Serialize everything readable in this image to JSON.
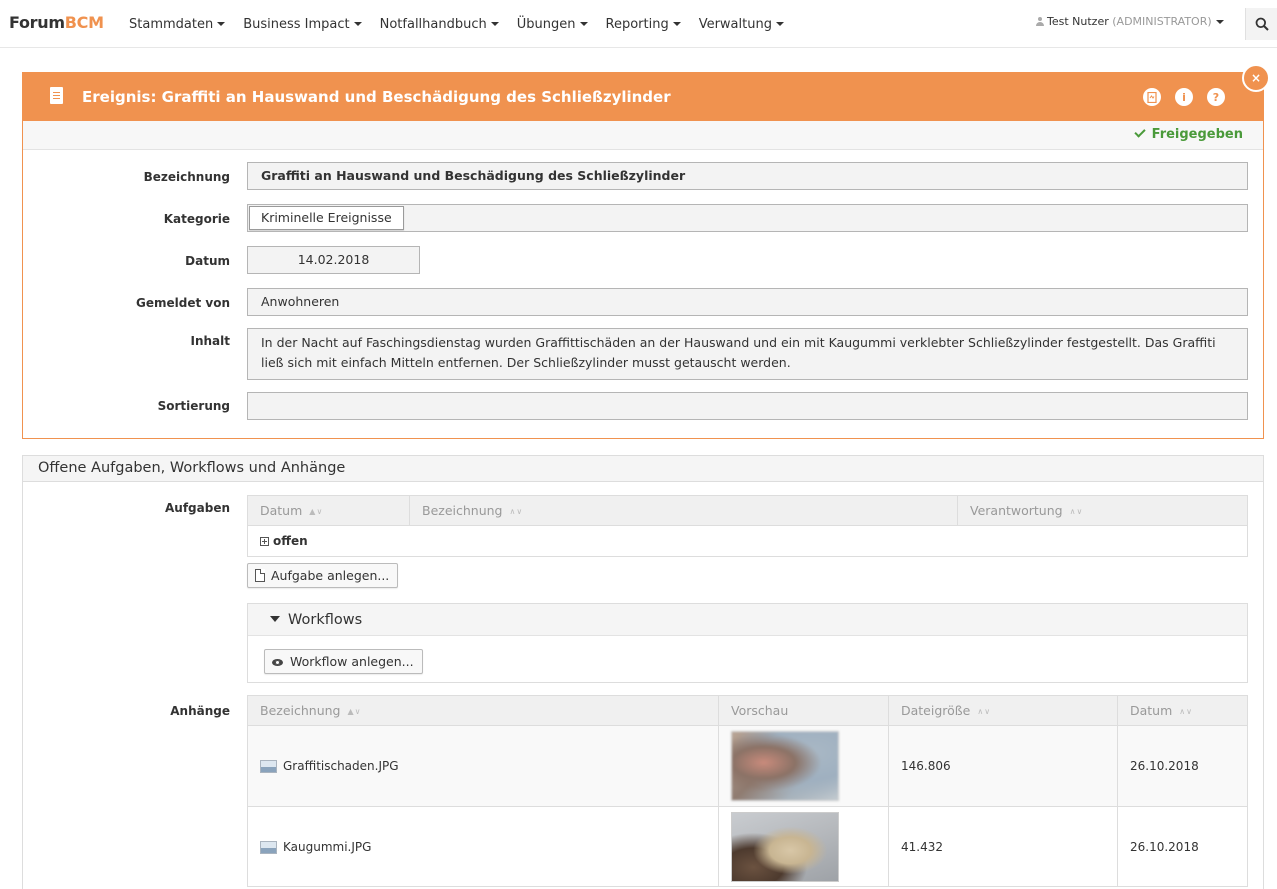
{
  "navbar": {
    "brand_prefix": "Forum",
    "brand_accent": "BCM",
    "menu": [
      {
        "label": "Stammdaten"
      },
      {
        "label": "Business Impact"
      },
      {
        "label": "Notfallhandbuch"
      },
      {
        "label": "Übungen"
      },
      {
        "label": "Reporting"
      },
      {
        "label": "Verwaltung"
      }
    ],
    "user_name": "Test Nutzer",
    "user_role": "(ADMINISTRATOR)",
    "search_icon": "search-icon"
  },
  "event": {
    "title": "Ereignis: Graffiti an Hauswand und Beschädigung des Schließzylinder",
    "header_icons": [
      "pdf-icon",
      "info-icon",
      "help-icon"
    ],
    "close_icon": "close-icon",
    "status": "Freigegeben",
    "fields": {
      "bezeichnung_label": "Bezeichnung",
      "bezeichnung_value": "Graffiti an Hauswand und Beschädigung des Schließzylinder",
      "kategorie_label": "Kategorie",
      "kategorie_value": "Kriminelle Ereignisse",
      "datum_label": "Datum",
      "datum_value": "14.02.2018",
      "gemeldet_label": "Gemeldet von",
      "gemeldet_value": "Anwohneren",
      "inhalt_label": "Inhalt",
      "inhalt_value": "In der Nacht auf Faschingsdienstag wurden Graffittischäden an der Hauswand und ein mit Kaugummi verklebter Schließzylinder festgestellt. Das Graffiti ließ sich mit einfach Mitteln entfernen. Der Schließzylinder musst getauscht werden.",
      "sortierung_label": "Sortierung",
      "sortierung_value": ""
    }
  },
  "tasks_panel": {
    "title": "Offene Aufgaben, Workflows und Anhänge",
    "aufgaben_label": "Aufgaben",
    "aufgaben_columns": [
      "Datum",
      "Bezeichnung",
      "Verantwortung"
    ],
    "group_label": "offen",
    "add_task_button": "Aufgabe anlegen...",
    "workflows_title": "Workflows",
    "add_workflow_button": "Workflow anlegen...",
    "anhaenge_label": "Anhänge",
    "anhaenge_columns": [
      "Bezeichnung",
      "Vorschau",
      "Dateigröße",
      "Datum"
    ],
    "attachments": [
      {
        "name": "Graffitischaden.JPG",
        "size": "146.806",
        "date": "26.10.2018"
      },
      {
        "name": "Kaugummi.JPG",
        "size": "41.432",
        "date": "26.10.2018"
      }
    ]
  },
  "colors": {
    "accent": "#f0924f",
    "status_green": "#4a9a3a"
  }
}
